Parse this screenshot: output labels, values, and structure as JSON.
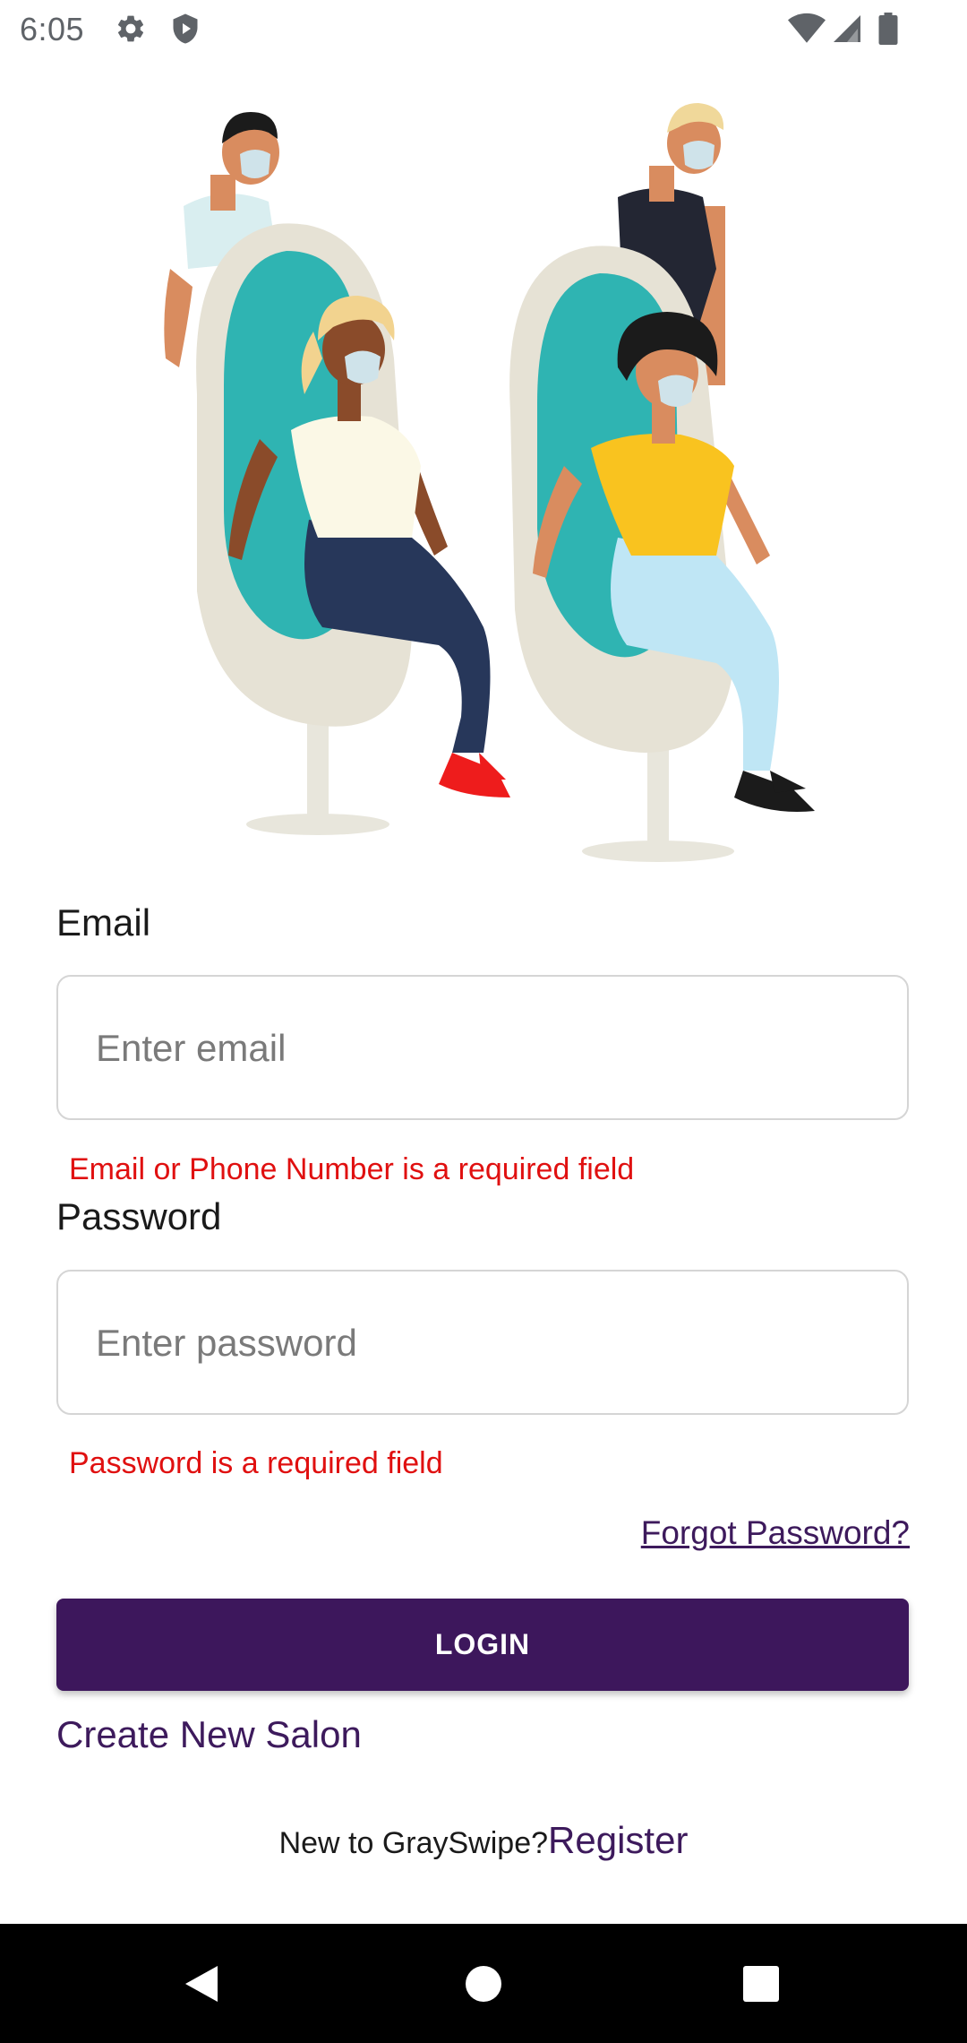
{
  "status_bar": {
    "time": "6:05",
    "left_icons": [
      "settings-gear-icon",
      "shield-icon"
    ],
    "right_icons": [
      "wifi-icon",
      "cellular-signal-icon",
      "battery-icon"
    ]
  },
  "illustration": {
    "subject": "salon-illustration"
  },
  "login_form": {
    "email": {
      "label": "Email",
      "placeholder": "Enter email",
      "value": "",
      "error": "Email or Phone Number is a required field"
    },
    "password": {
      "label": "Password",
      "placeholder": "Enter password",
      "value": "",
      "error": "Password is a required field"
    },
    "forgot_password": "Forgot Password?",
    "login_button": "LOGIN",
    "create_salon": "Create New Salon",
    "register_prompt": "New to GraySwipe?",
    "register_link": "Register"
  },
  "navigation_bar": {
    "buttons": [
      "back-icon",
      "home-icon",
      "recents-icon"
    ]
  },
  "colors": {
    "primary": "#3d175c",
    "error": "#e01010",
    "input_border": "#d5d5d5",
    "nav_bar": "#000000"
  }
}
